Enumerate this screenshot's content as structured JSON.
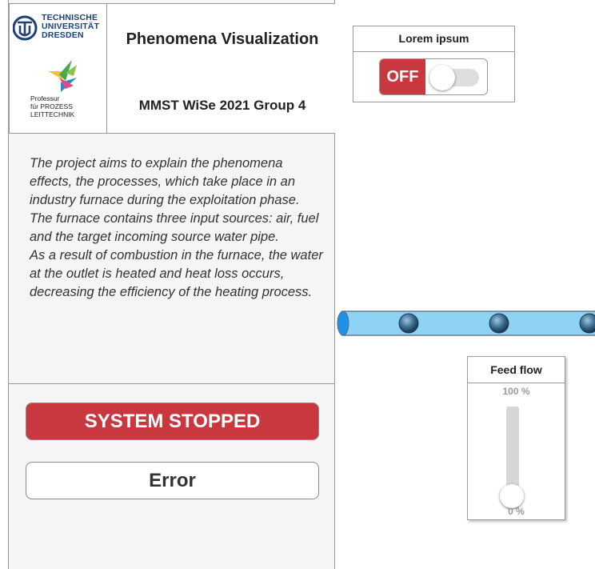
{
  "header": {
    "title": "Phenomena Visualization",
    "subtitle": "MMST WiSe 2021 Group 4",
    "logo_university_lines": [
      "TECHNISCHE",
      "UNIVERSITÄT",
      "DRESDEN"
    ],
    "logo_chair_lines": [
      "Professur",
      "für PROZESS",
      "LEITTECHNIK"
    ]
  },
  "description": {
    "paragraphs": [
      "The project aims to explain the phenomena effects, the processes, which take place in an industry furnace during the exploitation phase.",
      "The furnace contains three input sources: air, fuel and the target incoming source water pipe.",
      "As a result of combustion in the furnace, the water at the outlet is heated and heat loss occurs, decreasing the efficiency of the heating process."
    ]
  },
  "status": {
    "label": "SYSTEM STOPPED",
    "color": "#c9383f",
    "error_label": "Error"
  },
  "toggle": {
    "title": "Lorem ipsum",
    "state_label": "OFF",
    "on": false
  },
  "pipe": {
    "water_color": "#8fd3f4",
    "ball_icon": "flow-ball-icon"
  },
  "feed_flow": {
    "title": "Feed flow",
    "max_label": "100 %",
    "min_label": "0 %",
    "value_percent": 0
  },
  "colors": {
    "accent_red": "#c9383f",
    "tud_blue": "#1d3f7a",
    "panel_bg": "#f5f5f5"
  }
}
